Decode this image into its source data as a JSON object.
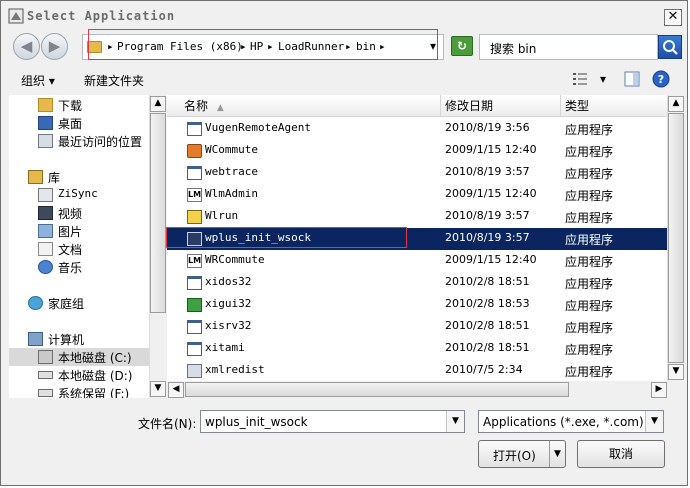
{
  "window": {
    "title": "Select Application",
    "close_symbol": "✕"
  },
  "address": {
    "crumbs": [
      "Program Files (x86)",
      "HP",
      "LoadRunner",
      "bin"
    ],
    "separator": "▸",
    "dropdown": "▾"
  },
  "search": {
    "placeholder": "搜索 bin"
  },
  "toolbar": {
    "organize": "组织 ▾",
    "new_folder": "新建文件夹",
    "view_dropdown": "▾"
  },
  "sidebar": {
    "items": [
      {
        "label": "下载",
        "icon": "download-folder-icon"
      },
      {
        "label": "桌面",
        "icon": "desktop-icon"
      },
      {
        "label": "最近访问的位置",
        "icon": "recent-places-icon"
      },
      {
        "label": "库",
        "icon": "library-icon"
      },
      {
        "label": "ZiSync",
        "icon": "zisync-icon"
      },
      {
        "label": "视频",
        "icon": "video-icon"
      },
      {
        "label": "图片",
        "icon": "pictures-icon"
      },
      {
        "label": "文档",
        "icon": "documents-icon"
      },
      {
        "label": "音乐",
        "icon": "music-icon"
      },
      {
        "label": "家庭组",
        "icon": "homegroup-icon"
      },
      {
        "label": "计算机",
        "icon": "computer-icon"
      },
      {
        "label": "本地磁盘 (C:)",
        "icon": "drive-c-icon"
      },
      {
        "label": "本地磁盘 (D:)",
        "icon": "drive-d-icon"
      },
      {
        "label": "系统保留 (F:)",
        "icon": "drive-f-icon"
      }
    ]
  },
  "columns": {
    "name": "名称",
    "date": "修改日期",
    "type": "类型"
  },
  "files": [
    {
      "name": "VugenRemoteAgent",
      "date": "2010/8/19 3:56",
      "type": "应用程序",
      "icon": "exe-window-icon"
    },
    {
      "name": "WCommute",
      "date": "2009/1/15 12:40",
      "type": "应用程序",
      "icon": "wcommute-icon"
    },
    {
      "name": "webtrace",
      "date": "2010/8/19 3:57",
      "type": "应用程序",
      "icon": "exe-window-icon"
    },
    {
      "name": "WlmAdmin",
      "date": "2009/1/15 12:40",
      "type": "应用程序",
      "icon": "lm-icon"
    },
    {
      "name": "Wlrun",
      "date": "2010/8/19 3:57",
      "type": "应用程序",
      "icon": "wlrun-icon"
    },
    {
      "name": "wplus_init_wsock",
      "date": "2010/8/19 3:57",
      "type": "应用程序",
      "icon": "wplus-icon"
    },
    {
      "name": "WRCommute",
      "date": "2009/1/15 12:40",
      "type": "应用程序",
      "icon": "lm-icon"
    },
    {
      "name": "xidos32",
      "date": "2010/2/8 18:51",
      "type": "应用程序",
      "icon": "exe-window-icon"
    },
    {
      "name": "xigui32",
      "date": "2010/2/8 18:53",
      "type": "应用程序",
      "icon": "xigui-icon"
    },
    {
      "name": "xisrv32",
      "date": "2010/2/8 18:51",
      "type": "应用程序",
      "icon": "exe-window-icon"
    },
    {
      "name": "xitami",
      "date": "2010/2/8 18:51",
      "type": "应用程序",
      "icon": "exe-window-icon"
    },
    {
      "name": "xmlredist",
      "date": "2010/7/5 2:34",
      "type": "应用程序",
      "icon": "installer-icon"
    }
  ],
  "selected_index": 5,
  "bottom": {
    "filename_label": "文件名(N):",
    "filename_value": "wplus_init_wsock",
    "filetype_value": "Applications (*.exe, *.com)",
    "open_label": "打开(O)",
    "cancel_label": "取消"
  },
  "colors": {
    "selection": "#0b2561",
    "highlight_box": "#e2364a"
  }
}
